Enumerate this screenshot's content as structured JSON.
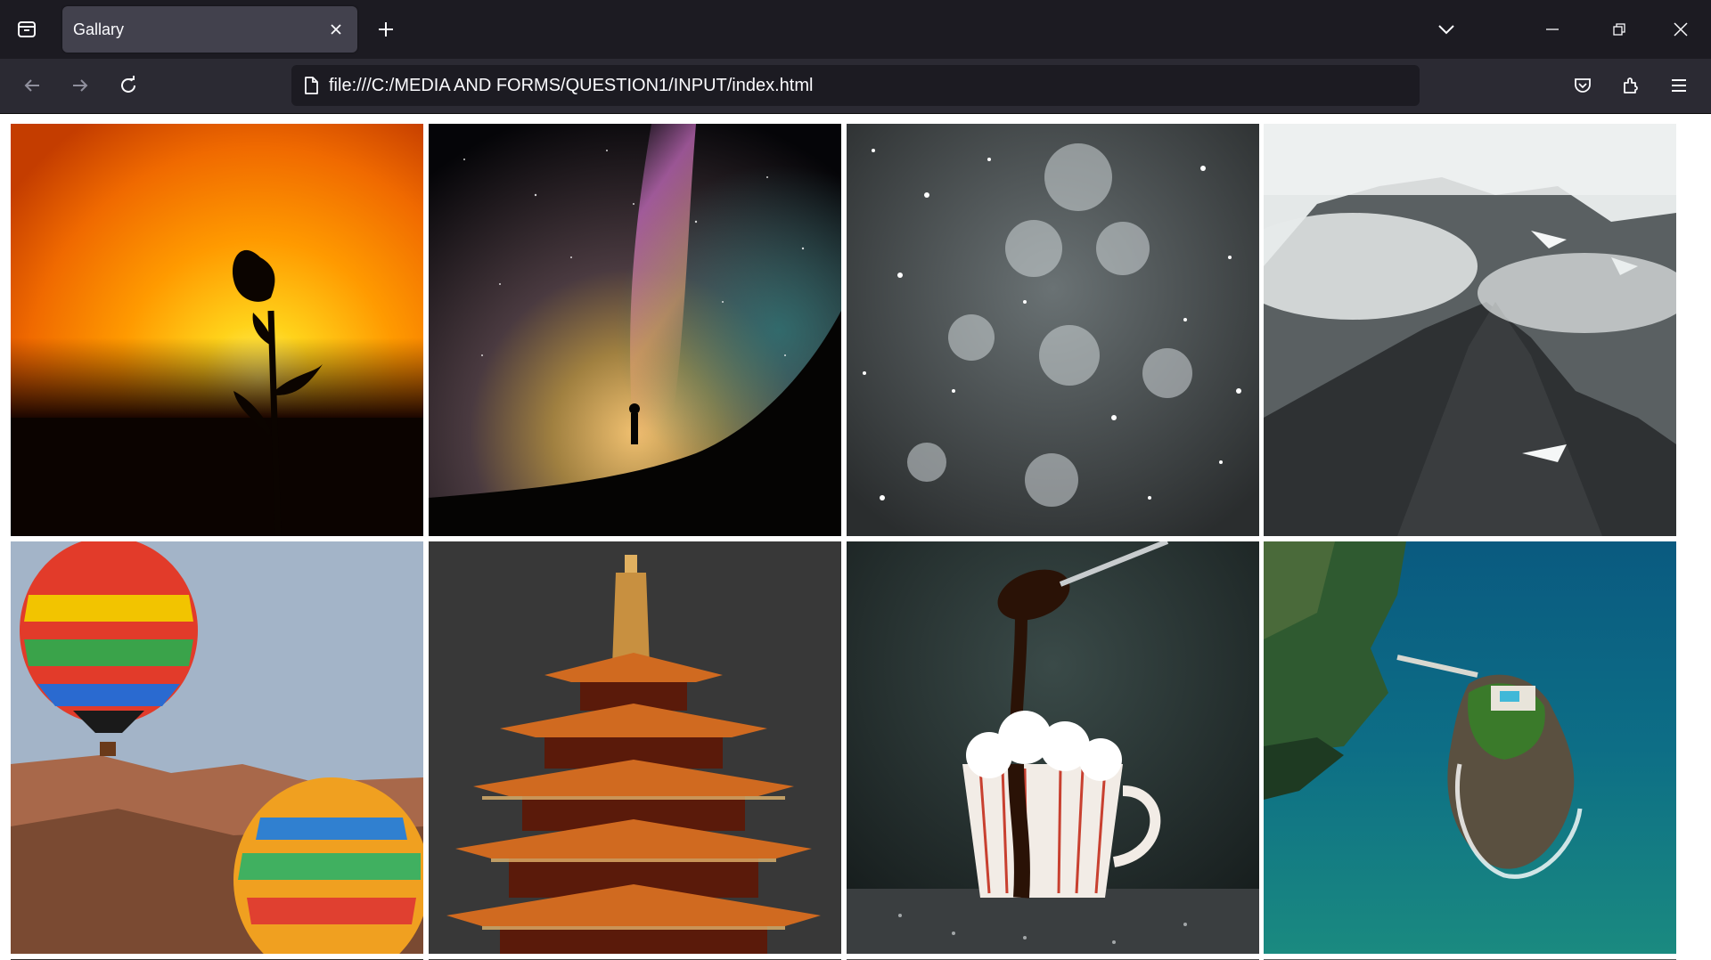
{
  "browser": {
    "tab": {
      "title": "Gallary"
    },
    "address_bar": {
      "url": "file:///C:/MEDIA AND FORMS/QUESTION1/INPUT/index.html"
    },
    "icons": [
      "tab-overview-icon",
      "close-icon",
      "plus-icon",
      "chevron-down-icon",
      "minimize-icon",
      "restore-icon",
      "window-close-icon",
      "back-arrow-icon",
      "forward-arrow-icon",
      "reload-icon",
      "page-icon",
      "star-icon",
      "pocket-icon",
      "extensions-icon",
      "menu-icon"
    ]
  },
  "gallery": {
    "images": [
      {
        "subject": "sunflower-silhouette-sunset"
      },
      {
        "subject": "milky-way-person-silhouette"
      },
      {
        "subject": "falling-snow-dark"
      },
      {
        "subject": "misty-mountain-peaks"
      },
      {
        "subject": "hot-air-balloons-canyon"
      },
      {
        "subject": "pagoda-lit-night"
      },
      {
        "subject": "hot-chocolate-cup-spoon"
      },
      {
        "subject": "aerial-island-sea"
      }
    ]
  }
}
